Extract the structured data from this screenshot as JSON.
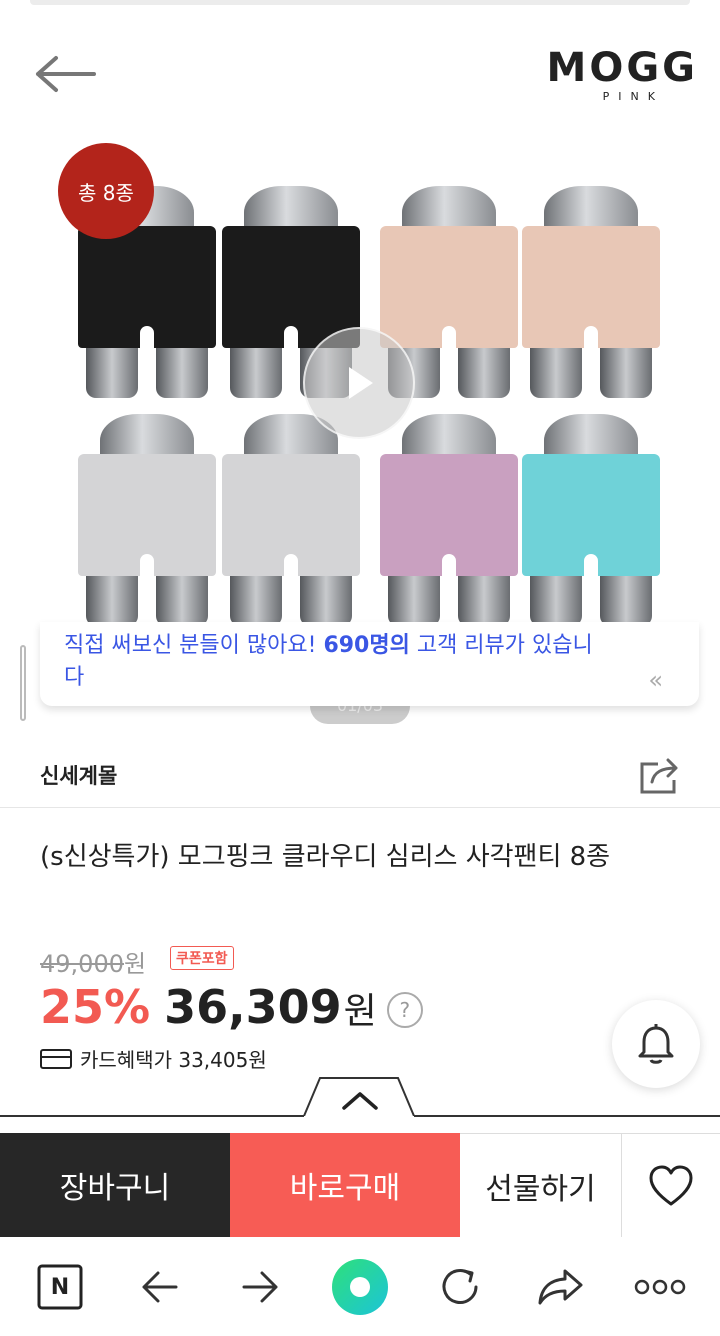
{
  "header": {
    "back_icon": "arrow-left-icon",
    "brand": {
      "main": "MOGG",
      "sub": "PINK"
    }
  },
  "gallery": {
    "badge": "총 8종",
    "play_icon": "play-icon",
    "page_indicator": "01/03",
    "garments": [
      {
        "color": "#1b1b1b"
      },
      {
        "color": "#1b1b1b"
      },
      {
        "color": "#e8c7b6"
      },
      {
        "color": "#e8c7b6"
      },
      {
        "color": "#d4d4d6"
      },
      {
        "color": "#d4d4d6"
      },
      {
        "color": "#c9a0c0"
      },
      {
        "color": "#6fd2d8"
      }
    ]
  },
  "review_banner": {
    "pre": "직접 써보신 분들이 많아요! ",
    "count": "690명의",
    "post": " 고객 리뷰가 있습니다",
    "arrow": "«"
  },
  "seller": {
    "name": "신세계몰",
    "share_icon": "share-icon"
  },
  "product": {
    "title": "(s신상특가) 모그핑크 클라우디 심리스 사각팬티 8종",
    "original_price": "49,000",
    "original_unit": "원",
    "coupon_badge": "쿠폰포함",
    "discount": "25%",
    "price": "36,309",
    "price_unit": "원",
    "help": "?",
    "card_benefit": "카드혜택가 33,405원"
  },
  "actions": {
    "cart": "장바구니",
    "buy": "바로구매",
    "gift": "선물하기",
    "like_icon": "heart-icon",
    "bell_icon": "bell-icon",
    "expand_icon": "chevron-up-icon"
  },
  "browser": {
    "icons": [
      "naver-n-icon",
      "back-arrow-icon",
      "forward-arrow-icon",
      "home-green-icon",
      "refresh-icon",
      "share-icon",
      "more-icon"
    ],
    "n_label": "N"
  },
  "colors": {
    "accent": "#f75c55",
    "review_blue": "#3a56e4",
    "badge_red": "#b3241b",
    "cart_dark": "#272727"
  }
}
